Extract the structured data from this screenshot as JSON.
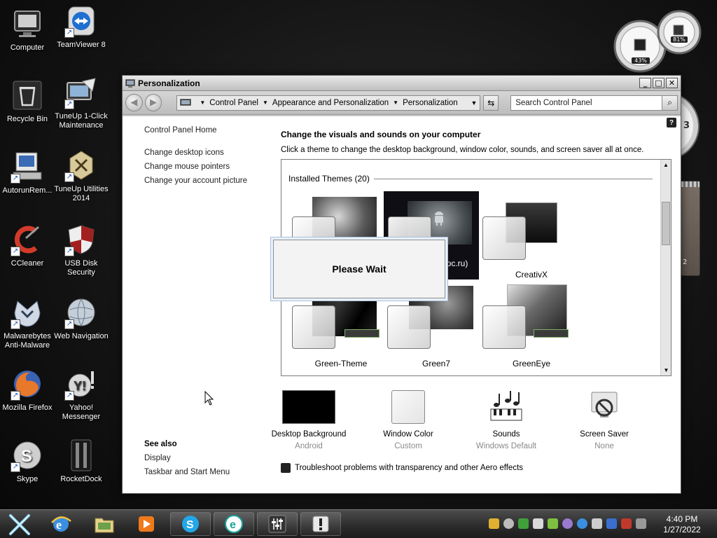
{
  "desktop": {
    "icons": [
      {
        "label": "Computer"
      },
      {
        "label": "TeamViewer 8"
      },
      {
        "label": "Recycle Bin"
      },
      {
        "label": "TuneUp 1-Click Maintenance"
      },
      {
        "label": "AutorunRem..."
      },
      {
        "label": "TuneUp Utilities 2014"
      },
      {
        "label": "CCleaner"
      },
      {
        "label": "USB Disk Security"
      },
      {
        "label": "Malwarebytes Anti-Malware"
      },
      {
        "label": "Web Navigation"
      },
      {
        "label": "Mozilla Firefox"
      },
      {
        "label": "Yahoo! Messenger"
      },
      {
        "label": "Skype"
      },
      {
        "label": "RocketDock"
      }
    ]
  },
  "gadgets": {
    "cpu_percent": "43%",
    "memory_percent": "81%",
    "clock_partial": "3",
    "note_partial": "2"
  },
  "window": {
    "title": "Personalization",
    "minimize": "_",
    "maximize": "□",
    "close": "✕",
    "breadcrumb": [
      "Control Panel",
      "Appearance and Personalization",
      "Personalization"
    ],
    "search_placeholder": "Search Control Panel",
    "help": "?"
  },
  "left_pane": {
    "home": "Control Panel Home",
    "links": [
      "Change desktop icons",
      "Change mouse pointers",
      "Change your account picture"
    ]
  },
  "see_also": {
    "heading": "See also",
    "links": [
      "Display",
      "Taskbar and Start Menu"
    ]
  },
  "main": {
    "heading": "Change the visuals and sounds on your computer",
    "description": "Click a theme to change the desktop background, window color, sounds, and screen saver all at once.",
    "themes_header": "Installed Themes (20)",
    "themes": [
      {
        "name": ""
      },
      {
        "name": "pc.ru)"
      },
      {
        "name": "CreativX"
      },
      {
        "name": "Green-Theme"
      },
      {
        "name": "Green7"
      },
      {
        "name": "GreenEye"
      }
    ]
  },
  "dialog": {
    "text": "Please Wait"
  },
  "bottom": [
    {
      "label": "Desktop Background",
      "sub": "Android"
    },
    {
      "label": "Window Color",
      "sub": "Custom"
    },
    {
      "label": "Sounds",
      "sub": "Windows Default"
    },
    {
      "label": "Screen Saver",
      "sub": "None"
    }
  ],
  "troubleshoot": "Troubleshoot problems with transparency and other Aero effects",
  "taskbar": {
    "time": "4:40 PM",
    "date": "1/27/2022"
  },
  "colors": {
    "accent": "#1e5fbf",
    "window_chrome": "#c9c9c9"
  }
}
